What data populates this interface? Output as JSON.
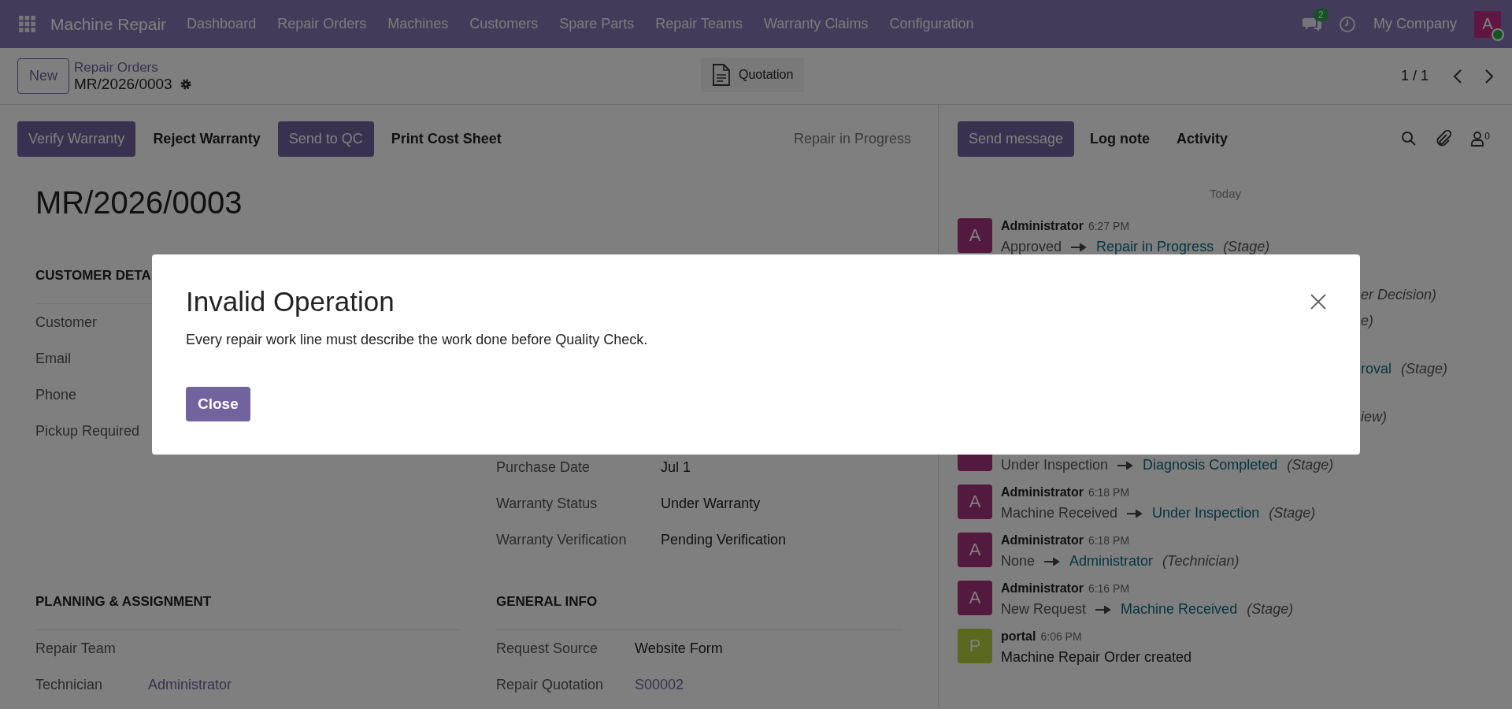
{
  "navbar": {
    "app_name": "Machine Repair",
    "menu": [
      "Dashboard",
      "Repair Orders",
      "Machines",
      "Customers",
      "Spare Parts",
      "Repair Teams",
      "Warranty Claims",
      "Configuration"
    ],
    "messages_count": "2",
    "company": "My Company",
    "avatar_letter": "A"
  },
  "control_panel": {
    "new_button": "New",
    "breadcrumb": "Repair Orders",
    "record": "MR/2026/0003",
    "smart_button": "Quotation",
    "pager": "1 / 1"
  },
  "actions": [
    {
      "label": "Verify Warranty",
      "kind": "primary"
    },
    {
      "label": "Reject Warranty",
      "kind": "plain"
    },
    {
      "label": "Send to QC",
      "kind": "primary"
    },
    {
      "label": "Print Cost Sheet",
      "kind": "plain"
    }
  ],
  "stage": "Repair in Progress",
  "chatter_actions": [
    {
      "label": "Send message",
      "kind": "primary"
    },
    {
      "label": "Log note",
      "kind": "plain"
    },
    {
      "label": "Activity",
      "kind": "plain"
    }
  ],
  "followers_count": "0",
  "form": {
    "title": "MR/2026/0003",
    "customer_section": {
      "title": "CUSTOMER DETA",
      "fields": [
        {
          "label": "Customer"
        },
        {
          "label": "Email"
        },
        {
          "label": "Phone"
        },
        {
          "label": "Pickup Required"
        }
      ]
    },
    "machine_fields": [
      {
        "label": "Purchase Date",
        "value": "Jul 1",
        "link": false
      },
      {
        "label": "Warranty Status",
        "value": "Under Warranty",
        "link": false
      },
      {
        "label": "Warranty Verification",
        "value": "Pending Verification",
        "link": false
      }
    ],
    "planning_section": {
      "title": "PLANNING & ASSIGNMENT",
      "fields": [
        {
          "label": "Repair Team"
        },
        {
          "label": "Technician",
          "value": "Administrator",
          "link": true
        }
      ]
    },
    "general_section": {
      "title": "GENERAL INFO",
      "fields": [
        {
          "label": "Request Source",
          "value": "Website Form",
          "link": false
        },
        {
          "label": "Repair Quotation",
          "value": "S00002",
          "link": true
        }
      ]
    }
  },
  "chatter": {
    "day": "Today",
    "messages": [
      {
        "kind": "full",
        "avatar": "A",
        "color": "#54193f",
        "author": "Administrator",
        "time": "6:27 PM",
        "old": "Approved",
        "new": "Repair in Progress",
        "field": "(Stage)"
      },
      {
        "kind": "covered",
        "lines": [
          {
            "field": "er Decision)"
          },
          {
            "field": "e)"
          }
        ]
      },
      {
        "kind": "covered",
        "lines": [
          {
            "link": "roval",
            "field": "(Stage)"
          }
        ]
      },
      {
        "kind": "covered",
        "lines": [
          {
            "field": "iew)"
          }
        ]
      },
      {
        "kind": "partial",
        "color": "#54193f",
        "old": "Under Inspection",
        "new": "Diagnosis Completed",
        "field": "(Stage)"
      },
      {
        "kind": "full",
        "avatar": "A",
        "color": "#54193f",
        "author": "Administrator",
        "time": "6:18 PM",
        "old": "Machine Received",
        "new": "Under Inspection",
        "field": "(Stage)"
      },
      {
        "kind": "full",
        "avatar": "A",
        "color": "#54193f",
        "author": "Administrator",
        "time": "6:18 PM",
        "old": "None",
        "new": "Administrator",
        "field": "(Technician)"
      },
      {
        "kind": "full",
        "avatar": "A",
        "color": "#54193f",
        "author": "Administrator",
        "time": "6:16 PM",
        "old": "New Request",
        "new": "Machine Received",
        "field": "(Stage)"
      },
      {
        "kind": "note",
        "avatar": "P",
        "color": "#5a6820",
        "author": "portal",
        "time": "6:06 PM",
        "body": "Machine Repair Order created"
      }
    ]
  },
  "dialog": {
    "title": "Invalid Operation",
    "message": "Every repair work line must describe the work done before Quality Check.",
    "button": "Close"
  }
}
